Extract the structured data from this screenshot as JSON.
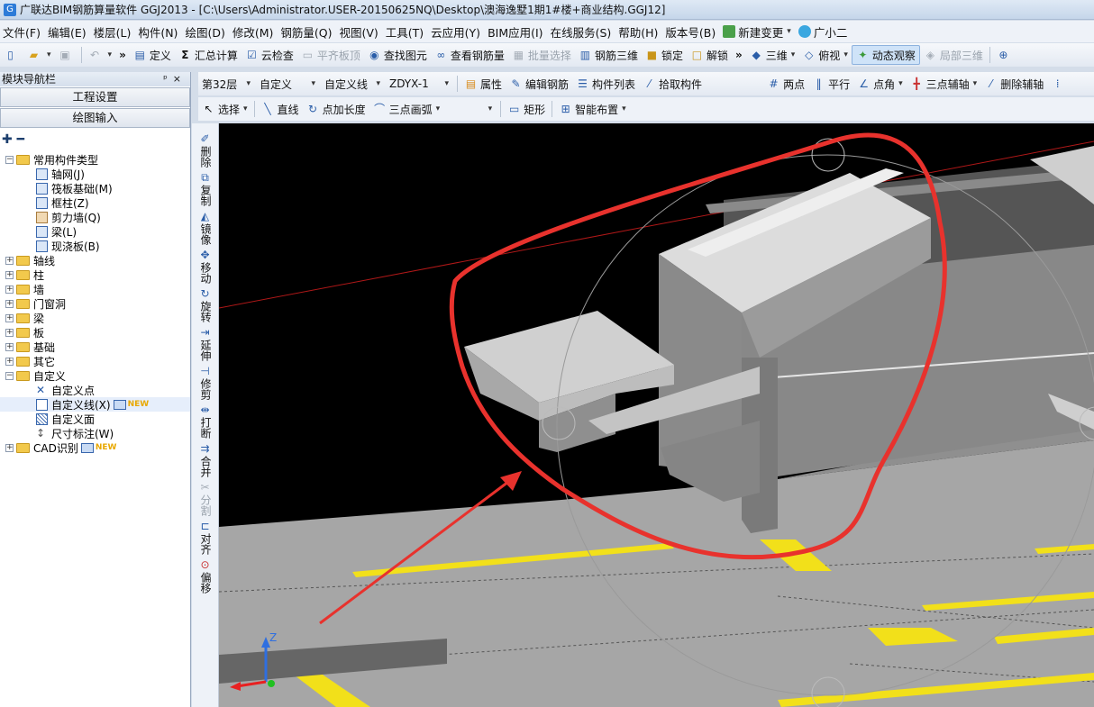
{
  "window": {
    "title": "广联达BIM钢筋算量软件 GGJ2013 - [C:\\Users\\Administrator.USER-20150625NQ\\Desktop\\澳海逸墅1期1#楼+商业结构.GGJ12]"
  },
  "menu": [
    "文件(F)",
    "编辑(E)",
    "楼层(L)",
    "构件(N)",
    "绘图(D)",
    "修改(M)",
    "钢筋量(Q)",
    "视图(V)",
    "工具(T)",
    "云应用(Y)",
    "BIM应用(I)",
    "在线服务(S)",
    "帮助(H)",
    "版本号(B)"
  ],
  "menu_extra": {
    "change": "新建变更",
    "assistant": "广小二"
  },
  "toolbar1": {
    "define": "定义",
    "sum": "汇总计算",
    "cloud_check": "云检查",
    "align_top": "平齐板顶",
    "find": "查找图元",
    "view_rebar": "查看钢筋量",
    "batch": "批量选择",
    "rebar3d": "钢筋三维",
    "lock": "锁定",
    "unlock": "解锁",
    "view3d": "三维",
    "top_view": "俯视",
    "orbit": "动态观察",
    "local3d": "局部三维"
  },
  "toolbar2": {
    "floor": "第32层",
    "type": "自定义",
    "subtype": "自定义线",
    "item": "ZDYX-1",
    "props": "属性",
    "edit_rebar": "编辑钢筋",
    "comp_list": "构件列表",
    "pick": "拾取构件",
    "two_pt": "两点",
    "parallel": "平行",
    "pt_angle": "点角",
    "three_pt_aux": "三点辅轴",
    "del_aux": "删除辅轴"
  },
  "toolbar3": {
    "select": "选择",
    "line": "直线",
    "pt_len": "点加长度",
    "arc": "三点画弧",
    "rect": "矩形",
    "smart": "智能布置"
  },
  "nav": {
    "header": "模块导航栏",
    "btn_project": "工程设置",
    "btn_draw": "绘图输入",
    "common": "常用构件类型",
    "common_items": [
      "轴网(J)",
      "筏板基础(M)",
      "框柱(Z)",
      "剪力墙(Q)",
      "梁(L)",
      "现浇板(B)"
    ],
    "folders": [
      "轴线",
      "柱",
      "墙",
      "门窗洞",
      "梁",
      "板",
      "基础",
      "其它"
    ],
    "custom": "自定义",
    "custom_items": [
      "自定义点",
      "自定义线(X)",
      "自定义面",
      "尺寸标注(W)"
    ],
    "cad": "CAD识别",
    "new_tag": "NEW"
  },
  "vtools": [
    {
      "label": "删除",
      "name": "delete"
    },
    {
      "label": "复制",
      "name": "copy"
    },
    {
      "label": "镜像",
      "name": "mirror"
    },
    {
      "label": "移动",
      "name": "move"
    },
    {
      "label": "旋转",
      "name": "rotate"
    },
    {
      "label": "延伸",
      "name": "extend"
    },
    {
      "label": "修剪",
      "name": "trim"
    },
    {
      "label": "打断",
      "name": "break"
    },
    {
      "label": "合并",
      "name": "merge"
    },
    {
      "label": "分割",
      "name": "split"
    },
    {
      "label": "对齐",
      "name": "align"
    },
    {
      "label": "偏移",
      "name": "offset"
    }
  ],
  "axis": {
    "z": "Z"
  },
  "colors": {
    "annotation": "#e8322d",
    "highlight": "#f2e01a",
    "ground": "#a6a6a6",
    "sky": "#000000"
  }
}
